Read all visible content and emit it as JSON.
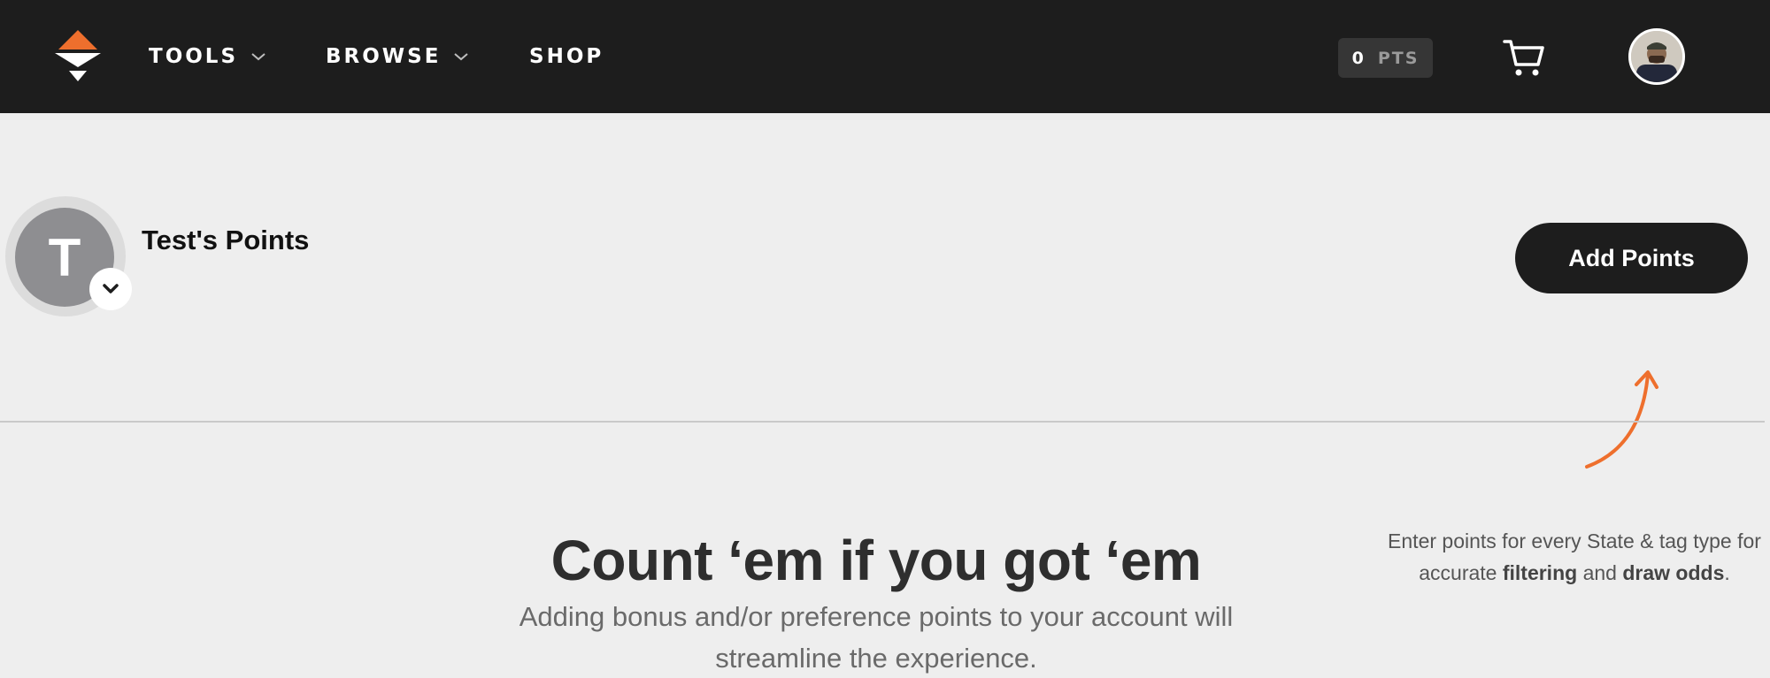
{
  "nav": {
    "logo_icon": "brand-logo-icon",
    "items": [
      {
        "label": "TOOLS",
        "has_dropdown": true
      },
      {
        "label": "BROWSE",
        "has_dropdown": true
      },
      {
        "label": "SHOP",
        "has_dropdown": false
      }
    ],
    "points_badge": {
      "value": "0",
      "label": "PTS"
    },
    "cart_icon": "cart-icon",
    "avatar_icon": "user-avatar"
  },
  "profile": {
    "initial": "T",
    "title": "Test's Points",
    "switch_icon": "chevron-down-icon"
  },
  "actions": {
    "add_points_label": "Add Points"
  },
  "hint": {
    "text_before": "Enter points for every State & tag type for accurate ",
    "bold_1": "filtering",
    "text_middle": " and ",
    "bold_2": "draw odds",
    "text_after": "."
  },
  "empty_state": {
    "headline": "Count ‘em if you got ‘em",
    "subline": "Adding bonus and/or preference points to your account will streamline the experience."
  },
  "colors": {
    "topbar": "#1d1d1d",
    "accent_orange": "#ee6f2d",
    "page_bg": "#eeeeee",
    "button_dark": "#1d1d1d"
  }
}
